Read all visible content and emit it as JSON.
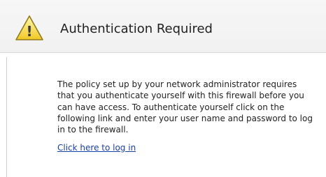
{
  "header": {
    "title": "Authentication Required",
    "icon": "warning-icon",
    "warning_color": "#f4d23a",
    "warning_glyph": "!"
  },
  "body": {
    "message": "The policy set up by your network administrator requires that you authenticate yourself with this firewall before you can have access. To authenticate yourself click on the following link and enter your user name and password to log in to the firewall.",
    "login_link": "Click here to log in",
    "link_color": "#1a3fa3"
  }
}
